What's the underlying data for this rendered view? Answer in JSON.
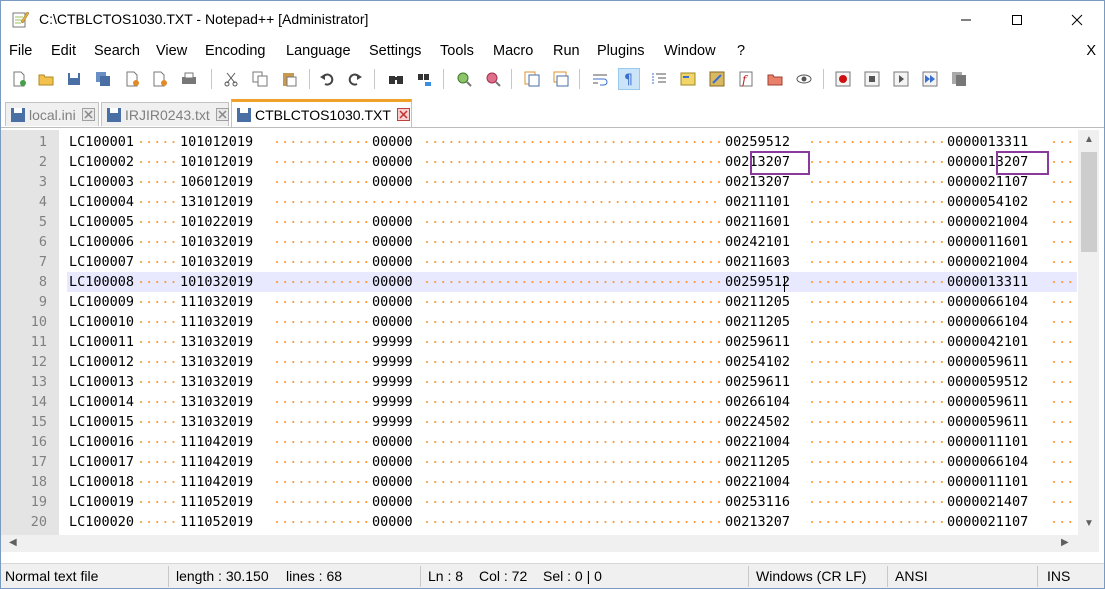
{
  "window": {
    "title": "C:\\CTBLCTOS1030.TXT - Notepad++ [Administrator]"
  },
  "menu": {
    "items": [
      "File",
      "Edit",
      "Search",
      "View",
      "Encoding",
      "Language",
      "Settings",
      "Tools",
      "Macro",
      "Run",
      "Plugins",
      "Window",
      "?"
    ],
    "close_label": "X"
  },
  "toolbar": {
    "buttons": [
      "new-file-icon",
      "open-file-icon",
      "save-icon",
      "save-all-icon",
      "close-icon",
      "close-all-icon",
      "print-icon",
      "cut-icon",
      "copy-icon",
      "paste-icon",
      "undo-icon",
      "redo-icon",
      "find-icon",
      "replace-icon",
      "zoom-in-icon",
      "zoom-out-icon",
      "sync-vertical-icon",
      "sync-horizontal-icon",
      "word-wrap-icon",
      "show-all-chars-icon",
      "indent-guide-icon",
      "user-language-icon",
      "doc-map-icon",
      "function-list-icon",
      "folder-workspace-icon",
      "monitoring-icon",
      "record-macro-icon",
      "stop-macro-icon",
      "play-macro-icon",
      "run-macro-multiple-icon",
      "save-macro-icon"
    ],
    "active": "show-all-chars-icon"
  },
  "tabs": [
    {
      "label": "local.ini",
      "active": false
    },
    {
      "label": "IRJIR0243.txt",
      "active": false
    },
    {
      "label": "CTBLCTOS1030.TXT",
      "active": true
    }
  ],
  "editor": {
    "current_line": 8,
    "lines": [
      {
        "no": "1",
        "c1": "LC100001",
        "c2": "101012019",
        "c3": "00000",
        "c4": "00259512",
        "c5": "0000013311"
      },
      {
        "no": "2",
        "c1": "LC100002",
        "c2": "101012019",
        "c3": "00000",
        "c4": "00213207",
        "c5": "0000013207"
      },
      {
        "no": "3",
        "c1": "LC100003",
        "c2": "106012019",
        "c3": "00000",
        "c4": "00213207",
        "c5": "0000021107"
      },
      {
        "no": "4",
        "c1": "LC100004",
        "c2": "131012019",
        "c3": "",
        "c4": "00211101",
        "c5": "0000054102"
      },
      {
        "no": "5",
        "c1": "LC100005",
        "c2": "101022019",
        "c3": "00000",
        "c4": "00211601",
        "c5": "0000021004"
      },
      {
        "no": "6",
        "c1": "LC100006",
        "c2": "101032019",
        "c3": "00000",
        "c4": "00242101",
        "c5": "0000011601"
      },
      {
        "no": "7",
        "c1": "LC100007",
        "c2": "101032019",
        "c3": "00000",
        "c4": "00211603",
        "c5": "0000021004"
      },
      {
        "no": "8",
        "c1": "LC100008",
        "c2": "101032019",
        "c3": "00000",
        "c4": "00259512",
        "c5": "0000013311"
      },
      {
        "no": "9",
        "c1": "LC100009",
        "c2": "111032019",
        "c3": "00000",
        "c4": "00211205",
        "c5": "0000066104"
      },
      {
        "no": "10",
        "c1": "LC100010",
        "c2": "111032019",
        "c3": "00000",
        "c4": "00211205",
        "c5": "0000066104"
      },
      {
        "no": "11",
        "c1": "LC100011",
        "c2": "131032019",
        "c3": "99999",
        "c4": "00259611",
        "c5": "0000042101"
      },
      {
        "no": "12",
        "c1": "LC100012",
        "c2": "131032019",
        "c3": "99999",
        "c4": "00254102",
        "c5": "0000059611"
      },
      {
        "no": "13",
        "c1": "LC100013",
        "c2": "131032019",
        "c3": "99999",
        "c4": "00259611",
        "c5": "0000059512"
      },
      {
        "no": "14",
        "c1": "LC100014",
        "c2": "131032019",
        "c3": "99999",
        "c4": "00266104",
        "c5": "0000059611"
      },
      {
        "no": "15",
        "c1": "LC100015",
        "c2": "131032019",
        "c3": "99999",
        "c4": "00224502",
        "c5": "0000059611"
      },
      {
        "no": "16",
        "c1": "LC100016",
        "c2": "111042019",
        "c3": "00000",
        "c4": "00221004",
        "c5": "0000011101"
      },
      {
        "no": "17",
        "c1": "LC100017",
        "c2": "111042019",
        "c3": "00000",
        "c4": "00211205",
        "c5": "0000066104"
      },
      {
        "no": "18",
        "c1": "LC100018",
        "c2": "111042019",
        "c3": "00000",
        "c4": "00221004",
        "c5": "0000011101"
      },
      {
        "no": "19",
        "c1": "LC100019",
        "c2": "111052019",
        "c3": "00000",
        "c4": "00253116",
        "c5": "0000021407"
      },
      {
        "no": "20",
        "c1": "LC100020",
        "c2": "111052019",
        "c3": "00000",
        "c4": "00213207",
        "c5": "0000021107"
      }
    ]
  },
  "statusbar": {
    "file_type": "Normal text file",
    "length": "length : 30.150",
    "lines": "lines : 68",
    "ln": "Ln : 8",
    "col": "Col : 72",
    "sel": "Sel : 0 | 0",
    "eol": "Windows (CR LF)",
    "encoding": "ANSI",
    "mode": "INS"
  },
  "colors": {
    "whitespace_dot": "#ff9933",
    "highlight_box": "#8a3a9a",
    "current_line": "#e8e8ff",
    "active_tab_accent": "#f0a12a"
  }
}
